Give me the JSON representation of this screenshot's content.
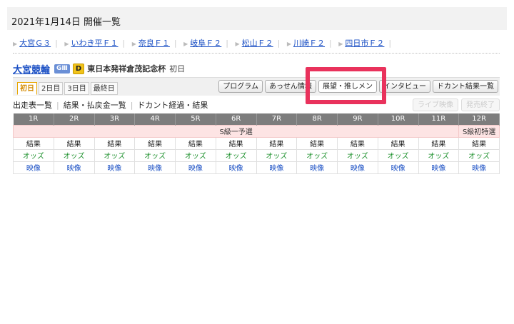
{
  "page": {
    "date_header": "2021年1月14日 開催一覧"
  },
  "venues": [
    {
      "label": "大宮Ｇ３"
    },
    {
      "label": "いわき平Ｆ１"
    },
    {
      "label": "奈良Ｆ１"
    },
    {
      "label": "岐阜Ｆ２"
    },
    {
      "label": "松山Ｆ２"
    },
    {
      "label": "川崎Ｆ２"
    },
    {
      "label": "四日市Ｆ２"
    }
  ],
  "race_info": {
    "track": "大宮競輪",
    "grade_badge": "GⅢ",
    "d_badge": "D",
    "cup_name": "東日本発祥倉茂記念杯",
    "day_label": "初日"
  },
  "day_tabs": [
    "初日",
    "2日目",
    "3日目",
    "最終日"
  ],
  "buttons": {
    "program": "プログラム",
    "assen": "あっせん情報",
    "tenbou": "展望・推しメン",
    "interview": "インタビュー",
    "dokanto": "ドカント結果一覧"
  },
  "sublinks": {
    "shussou": "出走表一覧",
    "kekka": "結果・払戻金一覧",
    "dokanto_keika": "ドカント経過・結果",
    "live": "ライブ映像",
    "hatsubai": "発売終了"
  },
  "races": {
    "headers": [
      "1R",
      "2R",
      "3R",
      "4R",
      "5R",
      "6R",
      "7R",
      "8R",
      "9R",
      "10R",
      "11R",
      "12R"
    ],
    "class_main": "S級一予選",
    "class_last": "S級初特選",
    "result_label": "結果",
    "odds_label": "オッズ",
    "video_label": "映像"
  },
  "colors": {
    "link": "#1a4fc4",
    "odds": "#1a8f2a",
    "highlight": "#e9325c",
    "header_bg": "#7d7d7d",
    "class_bg": "#fde4e4"
  }
}
